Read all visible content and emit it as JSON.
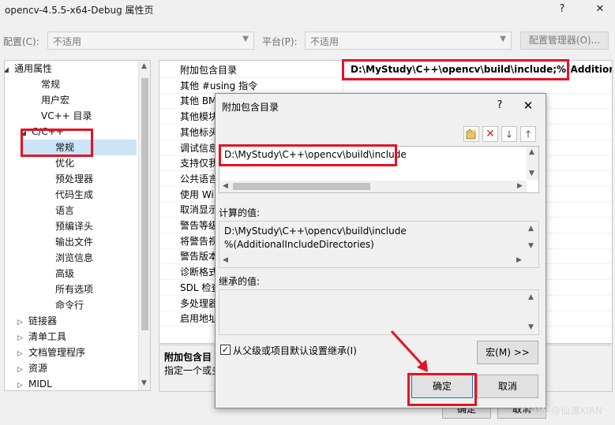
{
  "window": {
    "title": "opencv-4.5.5-x64-Debug 属性页",
    "help": "?",
    "close": "✕"
  },
  "config": {
    "config_label": "配置(C):",
    "config_value": "不适用",
    "platform_label": "平台(P):",
    "platform_value": "不适用",
    "manager_button": "配置管理器(O)..."
  },
  "tree": [
    {
      "label": "通用属性",
      "twist": "◢"
    },
    {
      "label": "常规"
    },
    {
      "label": "用户宏"
    },
    {
      "label": "VC++ 目录"
    },
    {
      "label": "C/C++",
      "twist": "◢"
    },
    {
      "label": "常规"
    },
    {
      "label": "优化"
    },
    {
      "label": "预处理器"
    },
    {
      "label": "代码生成"
    },
    {
      "label": "语言"
    },
    {
      "label": "预编译头"
    },
    {
      "label": "输出文件"
    },
    {
      "label": "浏览信息"
    },
    {
      "label": "高级"
    },
    {
      "label": "所有选项"
    },
    {
      "label": "命令行"
    },
    {
      "label": "链接器",
      "twist": "▷"
    },
    {
      "label": "清单工具",
      "twist": "▷"
    },
    {
      "label": "文档管理程序",
      "twist": "▷"
    },
    {
      "label": "资源",
      "twist": "▷"
    },
    {
      "label": "MIDL",
      "twist": "▷"
    }
  ],
  "grid": {
    "rows": [
      "附加包含目录",
      "其他 #using 指令",
      "其他 BM",
      "其他模块",
      "其他标头",
      "调试信息",
      "支持仅我",
      "公共语言",
      "使用 Wi",
      "取消显示",
      "警告等级",
      "将警告视",
      "警告版本",
      "诊断格式",
      "SDL 检查",
      "多处理器",
      "启用地址"
    ],
    "value": "D:\\MyStudy\\C++\\opencv\\build\\include;%(Additional"
  },
  "description": {
    "title": "附加包含目",
    "text": "指定一个或多"
  },
  "outer_buttons": {
    "ok": "确定",
    "cancel": "取消"
  },
  "modal": {
    "title": "附加包含目录",
    "help": "?",
    "close": "✕",
    "entry": "D:\\MyStudy\\C++\\opencv\\build\\include",
    "computed_label": "计算的值:",
    "computed_line1": "D:\\MyStudy\\C++\\opencv\\build\\include",
    "computed_line2": "%(AdditionalIncludeDirectories)",
    "inherited_label": "继承的值:",
    "inherit_checkbox": "从父级或项目默认设置继承(I)",
    "macro_button": "宏(M) >>",
    "ok": "确定",
    "cancel": "取消"
  },
  "watermark": "CSDN @仙渡XIAN",
  "colors": {
    "highlight": "#e81123",
    "selection": "#cce4f7",
    "delete_icon": "#c42b1c"
  }
}
